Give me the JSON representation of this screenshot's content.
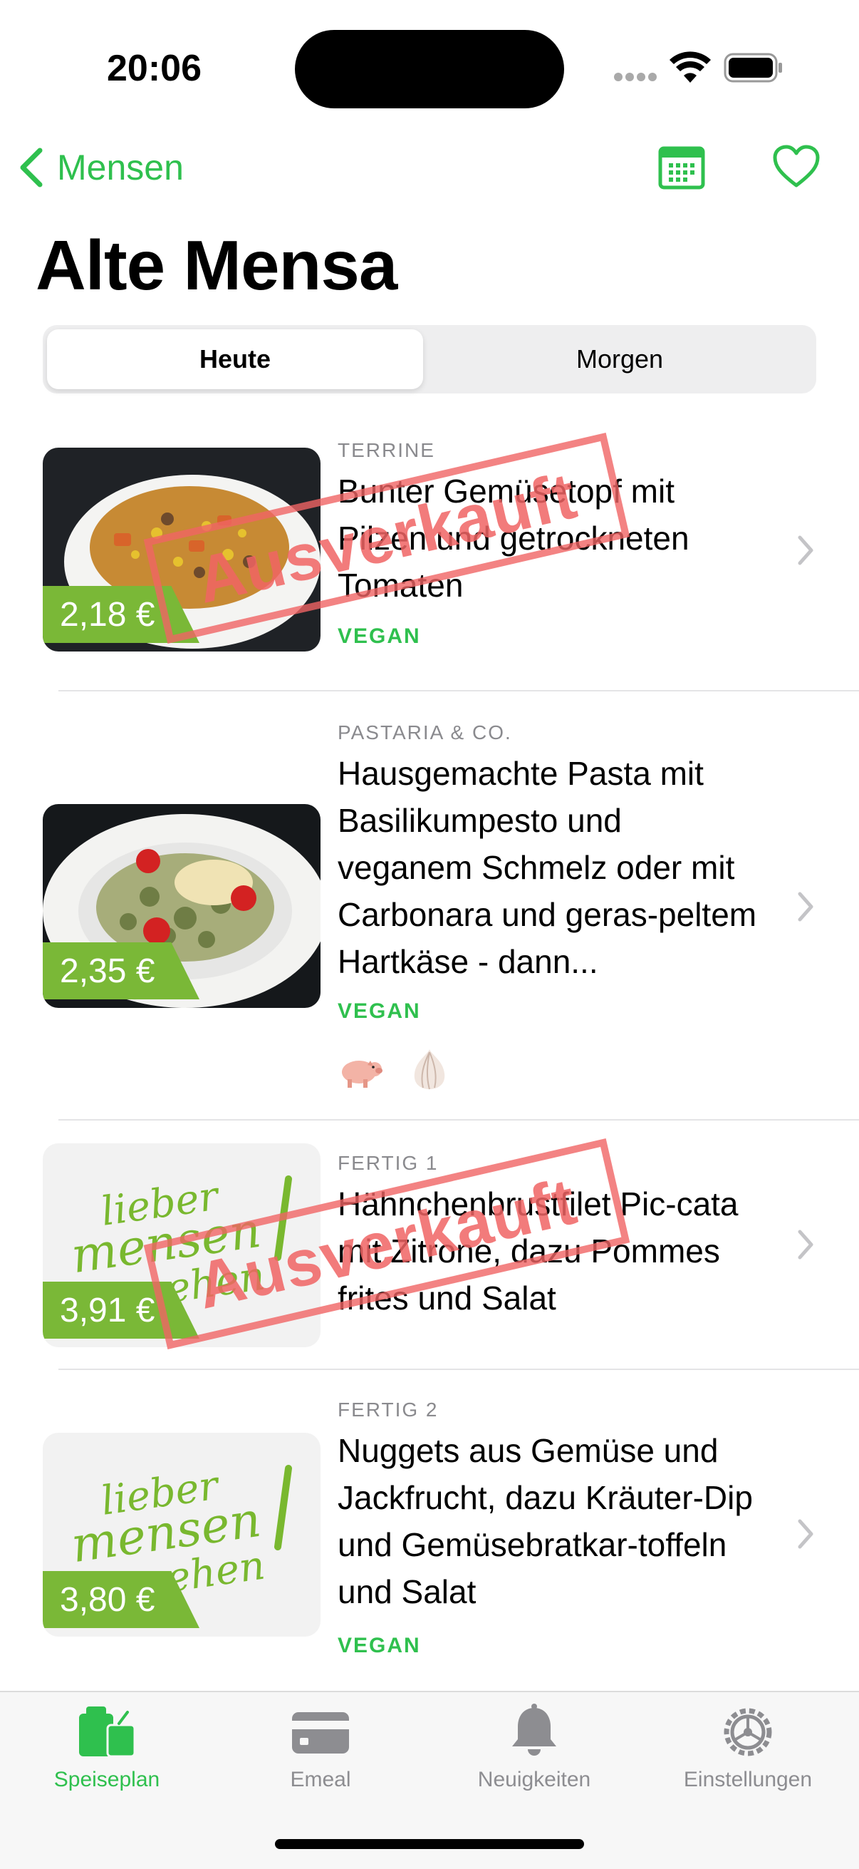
{
  "status_bar": {
    "time": "20:06"
  },
  "nav": {
    "back_label": "Mensen",
    "title": "Alte Mensa"
  },
  "segments": {
    "today": "Heute",
    "tomorrow": "Morgen",
    "selected": "Heute"
  },
  "stamp_text": "Ausverkauft",
  "meals": [
    {
      "category": "TERRINE",
      "title": "Bunter Gemüsetopf mit Pilzen und getrockneten Tomaten",
      "tag": "VEGAN",
      "price": "2,18 €",
      "sold_out": true,
      "image": "soup-photo"
    },
    {
      "category": "PASTARIA & CO.",
      "title": "Hausgemachte Pasta mit Basilikumpesto und veganem Schmelz oder mit Carbonara und geras-peltem Hartkäse - dann...",
      "tag": "VEGAN",
      "price": "2,35 €",
      "sold_out": false,
      "image": "pasta-photo",
      "icons": [
        "pig-icon",
        "garlic-icon"
      ]
    },
    {
      "category": "FERTIG 1",
      "title": "Hähnchenbrustfilet Pic-cata mit Zitrone, dazu Pommes frites und Salat",
      "tag": "",
      "price": "3,91 €",
      "sold_out": true,
      "image": "placeholder-logo"
    },
    {
      "category": "FERTIG 2",
      "title": "Nuggets aus Gemüse und Jackfrucht, dazu Kräuter-Dip und Gemüsebratkar-toffeln und Salat",
      "tag": "VEGAN",
      "price": "3,80 €",
      "sold_out": false,
      "image": "placeholder-logo"
    }
  ],
  "placeholder_logo_text": {
    "line1": "lieber",
    "line2": "mensen",
    "line3": "gehen"
  },
  "tabs": [
    {
      "label": "Speiseplan",
      "icon": "food-bag-icon",
      "active": true
    },
    {
      "label": "Emeal",
      "icon": "card-icon",
      "active": false
    },
    {
      "label": "Neuigkeiten",
      "icon": "bell-icon",
      "active": false
    },
    {
      "label": "Einstellungen",
      "icon": "gear-icon",
      "active": false
    }
  ],
  "colors": {
    "accent": "#2fc04e",
    "price_tag": "#7ab837",
    "stamp": "#f06464"
  }
}
